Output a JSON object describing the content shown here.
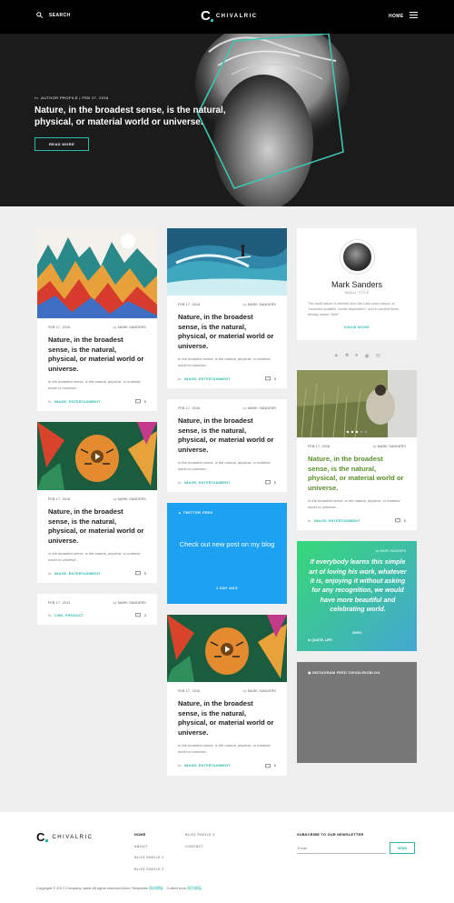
{
  "header": {
    "search_label": "SEARCH",
    "logo_mark": "C",
    "brand": "CHIVALRIC",
    "home_label": "HOME"
  },
  "hero": {
    "category_prefix": "In",
    "category": "AUTHOR PROFILE",
    "date": "FEB 17, 2016",
    "title": "Nature, in the broadest sense, is the natural, physical, or material world or universe.",
    "button": "READ MORE"
  },
  "cards": {
    "c1": {
      "date": "FEB 17, 2016",
      "by": "by",
      "author": "MARK SANDERS",
      "title": "Nature, in the broadest sense, is the natural, physical, or material world or universe.",
      "excerpt": "In the broadest sense, is the natural, physical, or material world or universe...",
      "in": "In",
      "tags": "IMAGE, ENTERTAINMENT",
      "comments": "5"
    },
    "c2": {
      "date": "FEB 17, 2016",
      "by": "by",
      "author": "MARK SANDERS",
      "title": "Nature, in the broadest sense, is the natural, physical, or material world or universe.",
      "excerpt": "In the broadest sense, is the natural, physical, or material world or universe...",
      "in": "In",
      "tags": "IMAGE, ENTERTAINMENT",
      "comments": "5"
    },
    "c3": {
      "date": "FEB 17, 2013",
      "by": "by",
      "author": "MARK SANDERS",
      "in": "In",
      "tags": "LINK, PRODUCT",
      "comments": "3"
    },
    "c4": {
      "date": "FEB 17, 2016",
      "by": "by",
      "author": "MARK SANDERS",
      "title": "Nature, in the broadest sense, is the natural, physical, or material world or universe.",
      "excerpt": "In the broadest sense, is the natural, physical, or material world or universe...",
      "in": "In",
      "tags": "IMAGE, ENTERTAINMENT",
      "comments": "5"
    },
    "c5": {
      "date": "FEB 17, 2016",
      "by": "by",
      "author": "MARK SANDERS",
      "title": "Nature, in the broadest sense, is the natural, physical, or material world or universe.",
      "excerpt": "In the broadest sense, is the natural, physical, or material world or universe...",
      "in": "In",
      "tags": "IMAGE, ENTERTAINMENT",
      "comments": "5"
    },
    "c6": {
      "date": "FEB 17, 2016",
      "by": "by",
      "author": "MARK SANDERS",
      "title": "Nature, in the broadest sense, is the natural, physical, or material world or universe.",
      "excerpt": "In the broadest sense, is the natural, physical, or material world or universe...",
      "in": "In",
      "tags": "IMAGE, ENTERTAINMENT",
      "comments": "5"
    },
    "c7": {
      "date": "FEB 17, 2016",
      "by": "by",
      "author": "MARK SANDERS",
      "title": "Nature, in the broadest sense, is the natural, physical, or material world or universe.",
      "excerpt": "In the broadest sense, is the natural, physical, or material world or universe...",
      "in": "In",
      "tags": "IMAGE, ENTERTAINMENT",
      "comments": "5"
    }
  },
  "twitter": {
    "label": "TWITTER FEED",
    "text": "Check out new post on my blog",
    "ago": "1 DAY AGO"
  },
  "profile": {
    "name": "Mark Sanders",
    "subtitle": "SMALL TITLE",
    "bio": "The word nature is derived from the Latin word natura, or \"essential qualities, innate disposition\", and in ancient times, literally meant \"birth\".",
    "more": "KNOW MORE"
  },
  "quote": {
    "by": "by",
    "author": "MARK SANDERS",
    "text": "If everybody learns this simple art of loving his work, whatever it is, enjoying it without asking for any recognition, we would have more beautiful and celebrating world.",
    "cite": "OSHO",
    "in": "In",
    "tags": "QUOTE, LIFE"
  },
  "instagram": {
    "label": "INSTAGRAM FEED CHIVALRICBLOG"
  },
  "footer": {
    "brand": "CHIVALRIC",
    "links_col1": [
      "HOME",
      "ABOUT",
      "BLOG SINGLE 1",
      "BLOG SINGLE 2"
    ],
    "links_col2": [
      "BLOG SINGLE 3",
      "CONTACT"
    ],
    "newsletter_title": "SUBSCRIBE TO OUR NEWSLETTER",
    "email_placeholder": "Email",
    "send": "SEND",
    "copyright": "Copyright © 2017 Company name All rights reserved.More Templates",
    "copyright_link1": "网站模板",
    "copyright_mid": "- Collect from",
    "copyright_link2": "网页模板"
  },
  "colors": {
    "accent": "#2bbbad",
    "twitter": "#1da1f2",
    "dark": "#1b1b1b"
  }
}
